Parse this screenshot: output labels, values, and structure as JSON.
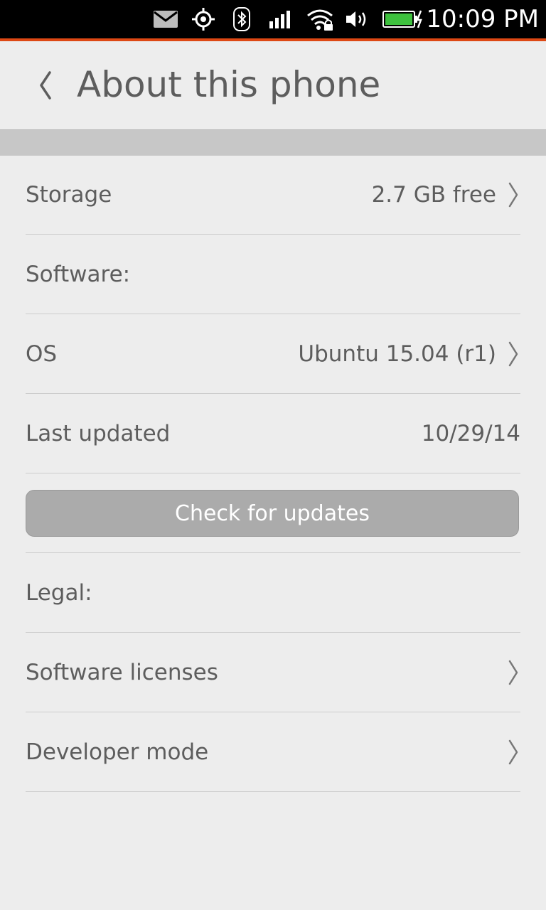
{
  "status_bar": {
    "time": "10:09 PM",
    "icons": [
      "mail-icon",
      "location-icon",
      "bluetooth-icon",
      "signal-icon",
      "wifi-icon",
      "volume-icon",
      "battery-icon"
    ]
  },
  "header": {
    "title": "About this phone"
  },
  "rows": {
    "storage": {
      "label": "Storage",
      "value": "2.7 GB free"
    },
    "software": {
      "label": "Software:"
    },
    "os": {
      "label": "OS",
      "value": "Ubuntu 15.04 (r1)"
    },
    "last_updated": {
      "label": "Last updated",
      "value": "10/29/14"
    },
    "check_updates": {
      "label": "Check for updates"
    },
    "legal": {
      "label": "Legal:"
    },
    "licenses": {
      "label": "Software licenses"
    },
    "developer": {
      "label": "Developer mode"
    }
  },
  "colors": {
    "accent": "#dd4814",
    "background": "#ededed",
    "battery": "#3ec13e"
  }
}
